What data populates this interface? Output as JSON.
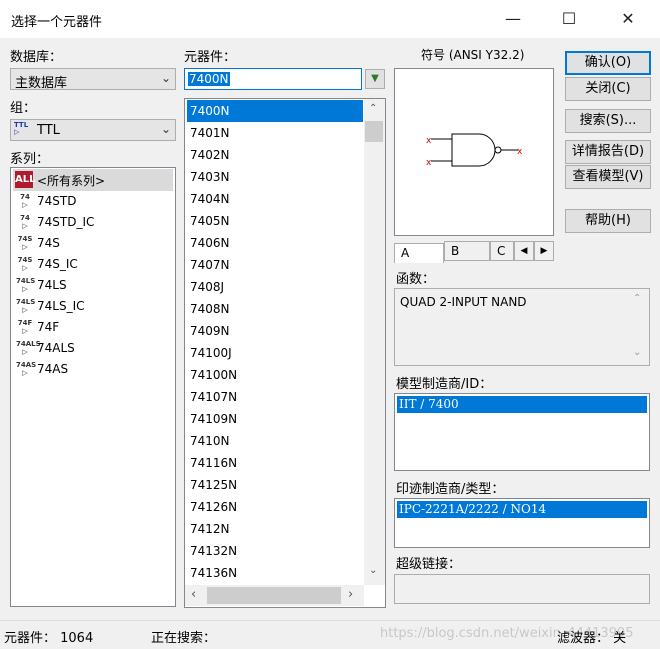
{
  "window": {
    "title": "选择一个元器件"
  },
  "database": {
    "label": "数据库：",
    "selected": "主数据库"
  },
  "group": {
    "label": "组：",
    "selected": "TTL"
  },
  "family": {
    "label": "系列：",
    "items": [
      {
        "label": "<所有系列>",
        "icon": "ALL"
      },
      {
        "label": "74STD",
        "icon": "74"
      },
      {
        "label": "74STD_IC",
        "icon": "74"
      },
      {
        "label": "74S",
        "icon": "74S"
      },
      {
        "label": "74S_IC",
        "icon": "74S"
      },
      {
        "label": "74LS",
        "icon": "74LS"
      },
      {
        "label": "74LS_IC",
        "icon": "74LS"
      },
      {
        "label": "74F",
        "icon": "74F"
      },
      {
        "label": "74ALS",
        "icon": "74ALS"
      },
      {
        "label": "74AS",
        "icon": "74AS"
      }
    ]
  },
  "components": {
    "label": "元器件：",
    "search_value": "7400N",
    "items": [
      "7400N",
      "7401N",
      "7402N",
      "7403N",
      "7404N",
      "7405N",
      "7406N",
      "7407N",
      "7408J",
      "7408N",
      "7409N",
      "74100J",
      "74100N",
      "74107N",
      "74109N",
      "7410N",
      "74116N",
      "74125N",
      "74126N",
      "7412N",
      "74132N",
      "74136N"
    ]
  },
  "symbol": {
    "label": "符号 (ANSI Y32.2)",
    "tabs": [
      "A",
      "B",
      "C"
    ]
  },
  "function": {
    "label": "函数：",
    "text": "QUAD 2-INPUT NAND"
  },
  "model_mfr": {
    "label": "模型制造商/ID：",
    "value": "IIT / 7400"
  },
  "footprint_mfr": {
    "label": "印迹制造商/类型：",
    "value": "IPC-2221A/2222 / NO14"
  },
  "hyperlink": {
    "label": "超级链接："
  },
  "buttons": {
    "ok": "确认(O)",
    "close": "关闭(C)",
    "search": "搜索(S)...",
    "detail": "详情报告(D)",
    "view_model": "查看模型(V)",
    "help": "帮助(H)"
  },
  "status": {
    "count": "元器件：  1064",
    "searching": "正在搜索：",
    "filter": "滤波器：  关",
    "watermark": "https://blog.csdn.net/weixin_44413995"
  }
}
